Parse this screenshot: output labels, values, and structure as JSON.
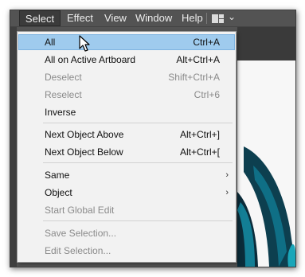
{
  "menubar": {
    "items": [
      {
        "label": "Select"
      },
      {
        "label": "Effect"
      },
      {
        "label": "View"
      },
      {
        "label": "Window"
      },
      {
        "label": "Help"
      }
    ],
    "workspace_icon": "workspace-layout-icon",
    "chevron_icon": "chevron-down-icon"
  },
  "menu": {
    "items": [
      {
        "label": "All",
        "shortcut": "Ctrl+A",
        "state": "highlighted"
      },
      {
        "label": "All on Active Artboard",
        "shortcut": "Alt+Ctrl+A",
        "state": "enabled"
      },
      {
        "label": "Deselect",
        "shortcut": "Shift+Ctrl+A",
        "state": "disabled"
      },
      {
        "label": "Reselect",
        "shortcut": "Ctrl+6",
        "state": "disabled"
      },
      {
        "label": "Inverse",
        "shortcut": "",
        "state": "enabled"
      },
      {
        "label": "Next Object Above",
        "shortcut": "Alt+Ctrl+]",
        "state": "enabled"
      },
      {
        "label": "Next Object Below",
        "shortcut": "Alt+Ctrl+[",
        "state": "enabled"
      },
      {
        "label": "Same",
        "shortcut": "",
        "state": "enabled",
        "submenu": true
      },
      {
        "label": "Object",
        "shortcut": "",
        "state": "enabled",
        "submenu": true
      },
      {
        "label": "Start Global Edit",
        "shortcut": "",
        "state": "disabled"
      },
      {
        "label": "Save Selection...",
        "shortcut": "",
        "state": "disabled"
      },
      {
        "label": "Edit Selection...",
        "shortcut": "",
        "state": "disabled"
      }
    ],
    "submenu_arrow": "›"
  },
  "colors": {
    "menubar_bg": "#535353",
    "menu_bg": "#f2f2f2",
    "highlight": "#9fcbee",
    "disabled_text": "#8a8a8a",
    "artwork_teal": "#0e5d6e"
  }
}
